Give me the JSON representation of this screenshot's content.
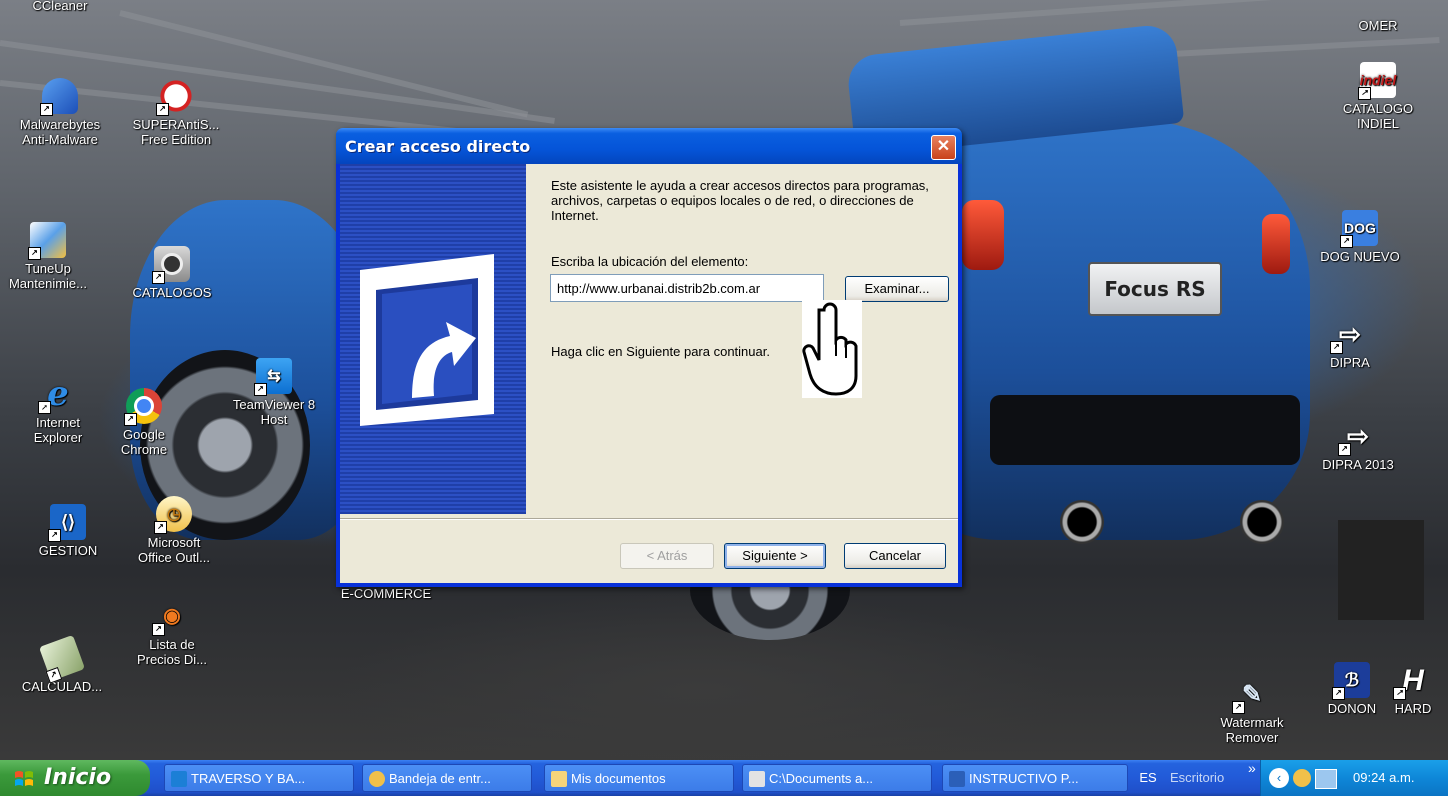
{
  "desktop_icons": {
    "ccleaner": "CCleaner",
    "malwarebytes": [
      "Malwarebytes",
      "Anti-Malware"
    ],
    "superantispyware": [
      "SUPERAntiS...",
      "Free Edition"
    ],
    "tuneup": [
      "TuneUp",
      "Mantenimie..."
    ],
    "catalogos": "CATALOGOS",
    "teamviewer": [
      "TeamViewer 8",
      "Host"
    ],
    "ie": [
      "Internet",
      "Explorer"
    ],
    "chrome": [
      "Google",
      "Chrome"
    ],
    "gestion": "GESTION",
    "outlook": [
      "Microsoft",
      "Office Outl..."
    ],
    "ecommerce": "E-COMMERCE",
    "lista": [
      "Lista de",
      "Precios Di..."
    ],
    "calculadora": "CALCULAD...",
    "omer": "OMER",
    "catalogo_indiel": [
      "CATALOGO",
      "INDIEL"
    ],
    "dog_nuevo": "DOG NUEVO",
    "dipra": "DIPRA",
    "dipra2013": "DIPRA 2013",
    "watermark": [
      "Watermark",
      "Remover"
    ],
    "donon": "DONON",
    "hard": "HARD",
    "indiel_logo": "indiel",
    "dog_logo": "DOG"
  },
  "dialog": {
    "title": "Crear acceso directo",
    "description": "Este asistente le ayuda a crear accesos directos para programas, archivos, carpetas o equipos locales o de red, o direcciones de Internet.",
    "location_label": "Escriba la ubicación del elemento:",
    "location_value": "http://www.urbanai.distrib2b.com.ar",
    "browse_label": "Examinar...",
    "continue_text": "Haga clic en Siguiente para continuar.",
    "back_label": "< Atrás",
    "next_label": "Siguiente >",
    "cancel_label": "Cancelar"
  },
  "car_badge": "Focus RS",
  "taskbar": {
    "start_label": "Inicio",
    "tasks": [
      "TRAVERSO Y BA...",
      "Bandeja de entr...",
      "Mis documentos",
      "C:\\Documents a...",
      "INSTRUCTIVO P..."
    ],
    "language": "ES",
    "desktop_toolbar": "Escritorio",
    "clock": "09:24 a.m."
  },
  "colors": {
    "xp_blue": "#0a5fe0",
    "start_green": "#3b9a3b",
    "dialog_face": "#ece9d8"
  }
}
